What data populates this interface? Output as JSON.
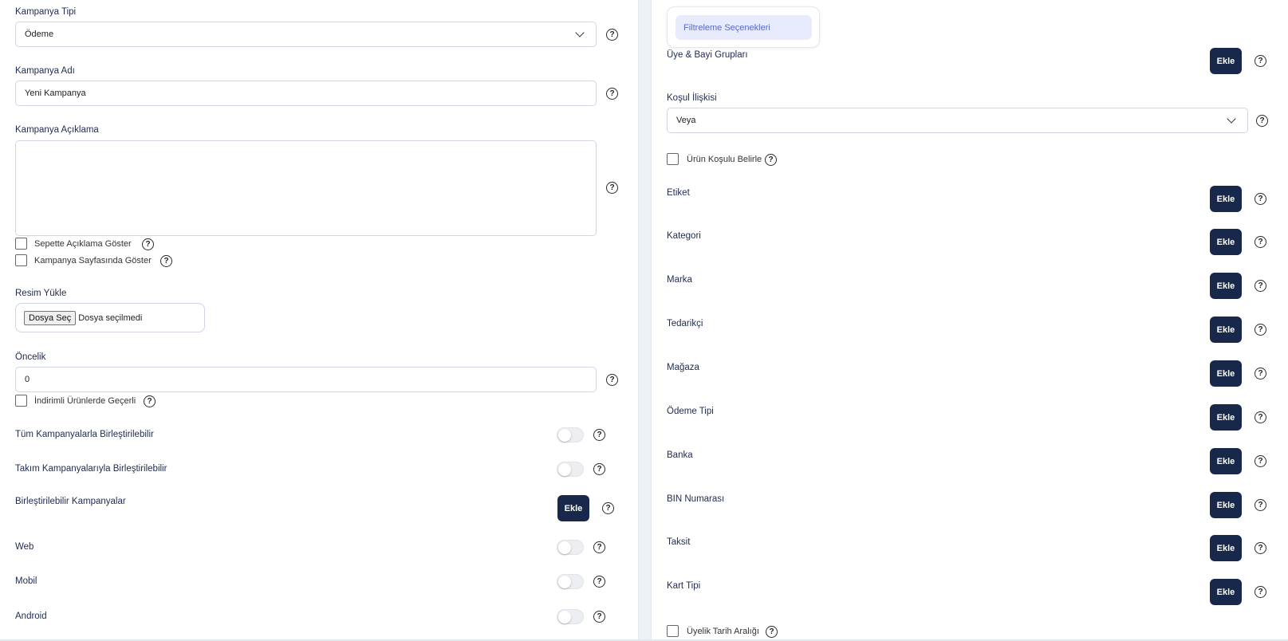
{
  "left": {
    "campaign_type": {
      "label": "Kampanya Tipi",
      "value": "Ödeme"
    },
    "campaign_name": {
      "label": "Kampanya Adı",
      "value": "Yeni Kampanya"
    },
    "campaign_description": {
      "label": "Kampanya Açıklama",
      "value": ""
    },
    "show_desc_in_cart": "Sepette Açıklama Göster",
    "show_on_campaign_page": "Kampanya Sayfasında Göster",
    "image_upload": {
      "label": "Resim Yükle",
      "button": "Dosya Seç",
      "status": "Dosya seçilmedi"
    },
    "priority": {
      "label": "Öncelik",
      "value": "0"
    },
    "valid_on_discounted": "İndirimli Ürünlerde Geçerli",
    "combinable_all": "Tüm Kampanyalarla Birleştirilebilir",
    "combinable_team": "Takım Kampanyalarıyla Birleştirilebilir",
    "combinable_campaigns": "Birleştirilebilir Kampanyalar",
    "web": "Web",
    "mobile": "Mobil",
    "android": "Android"
  },
  "right": {
    "filter_tab": "Filtreleme Seçenekleri",
    "member_groups": "Üye & Bayi Grupları",
    "condition_relation": {
      "label": "Koşul İlişkisi",
      "value": "Veya"
    },
    "product_condition": "Ürün Koşulu Belirle",
    "tag": "Etiket",
    "category": "Kategori",
    "brand": "Marka",
    "supplier": "Tedarikçi",
    "store": "Mağaza",
    "payment_type": "Ödeme Tipi",
    "bank": "Banka",
    "bin": "BIN Numarası",
    "installment": "Taksit",
    "card_type": "Kart Tipi",
    "membership_date_range": "Üyelik Tarih Aralığı"
  },
  "common": {
    "add_label": "Ekle",
    "help_glyph": "?"
  }
}
